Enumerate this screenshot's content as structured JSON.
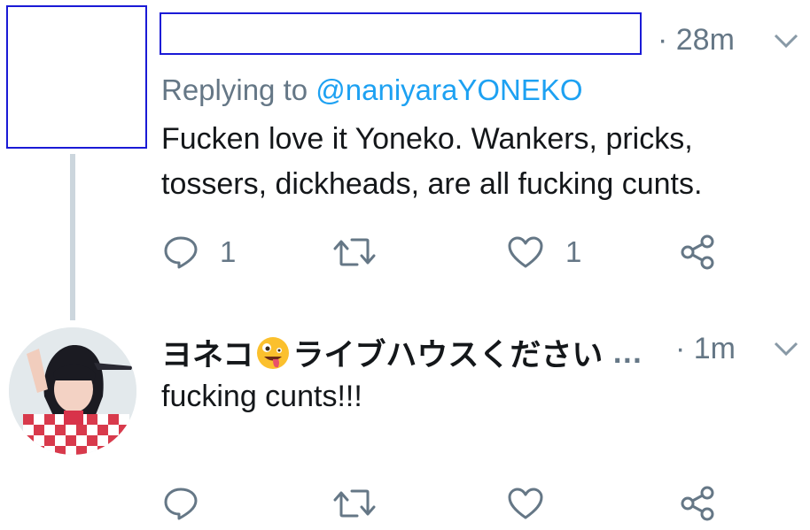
{
  "tweet1": {
    "time": "· 28m",
    "reply_prefix": "Replying to ",
    "reply_mention": "@naniyaraYONEKO",
    "text_line1": "Fucken love it Yoneko.  Wankers, pricks,",
    "text_line2": "tossers, dickheads, are all fucking cunts.",
    "reply_count": "1",
    "like_count": "1"
  },
  "tweet2": {
    "name_part1": "ヨネコ",
    "name_part2": "ライブハウスください",
    "name_ellipsis": "…",
    "time": "· 1m",
    "text": "fucking cunts!!!"
  },
  "icons": {
    "reply": "reply-bubble-icon",
    "retweet": "retweet-arrows-icon",
    "like": "heart-icon",
    "share": "share-nodes-icon",
    "caret": "chevron-down-icon",
    "emoji": "zany-face-emoji"
  },
  "colors": {
    "text": "#14171a",
    "muted": "#657786",
    "link": "#1da1f2",
    "thread_line": "#ccd6dd",
    "redaction_border": "#1a1ad6"
  }
}
